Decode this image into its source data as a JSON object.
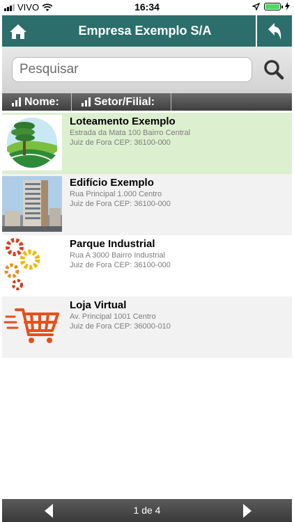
{
  "status_bar": {
    "carrier": "VIVO",
    "time": "16:34"
  },
  "header": {
    "title": "Empresa Exemplo S/A"
  },
  "search": {
    "placeholder": "Pesquisar",
    "value": ""
  },
  "columns": [
    {
      "label": "Nome:"
    },
    {
      "label": "Setor/Filial:"
    }
  ],
  "rows": [
    {
      "name": "Loteamento Exemplo",
      "address": "Estrada da Mata 100 Bairro Central",
      "city": "Juiz de Fora CEP: 36100-000",
      "icon": "landscape-tree",
      "background": "#dcefcf"
    },
    {
      "name": "Edifício Exemplo",
      "address": "Rua Principal 1.000 Centro",
      "city": "Juiz de Fora CEP: 36100-000",
      "icon": "building-photo",
      "background": "#f2f2f2"
    },
    {
      "name": "Parque Industrial",
      "address": "Rua A 3000 Bairro Industrial",
      "city": "Juiz de Fora CEP: 36100-000",
      "icon": "gears",
      "background": "#ffffff"
    },
    {
      "name": "Loja Virtual",
      "address": "Av. Principal 1001 Centro",
      "city": "Juiz de Fora CEP: 36000-010",
      "icon": "shopping-cart",
      "background": "#f2f2f2"
    }
  ],
  "pager": {
    "text": "1 de 4",
    "current": 1,
    "total": 4
  },
  "colors": {
    "header": "#2b6e6b",
    "selected_row": "#dcefcf",
    "alt_row": "#f2f2f2"
  }
}
